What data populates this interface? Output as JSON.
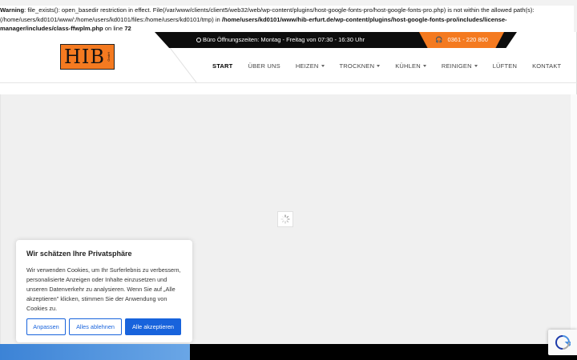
{
  "warning": {
    "label": "Warning",
    "message": ": file_exists(): open_basedir restriction in effect. File(/var/www/clients/client5/web32/web/wp-content/plugins/host-google-fonts-pro/host-google-fonts-pro.php) is not within the allowed path(s): (/home/users/kd0101/www/:/home/users/kd0101/files:/home/users/kd0101/tmp) in ",
    "path": "/home/users/kd0101/www/hib-erfurt.de/wp-content/plugins/host-google-fonts-pro/includes/license-manager/includes/class-ffwplm.php",
    "on_line": " on line ",
    "line": "72"
  },
  "logo": {
    "text": "HIB",
    "sub": "GmbH"
  },
  "topbar": {
    "hours": "Büro Öffnungszeiten: Montag - Freitag von 07:30 - 16:30 Uhr",
    "phone": "0361 - 220 800"
  },
  "nav": {
    "items": [
      {
        "label": "START"
      },
      {
        "label": "ÜBER UNS"
      },
      {
        "label": "HEIZEN"
      },
      {
        "label": "TROCKNEN"
      },
      {
        "label": "KÜHLEN"
      },
      {
        "label": "REINIGEN"
      },
      {
        "label": "LÜFTEN"
      },
      {
        "label": "KONTAKT"
      }
    ]
  },
  "cookie": {
    "title": "Wir schätzen Ihre Privatsphäre",
    "text": "Wir verwenden Cookies, um Ihr Surferlebnis zu verbessern, personalisierte Anzeigen oder Inhalte einzusetzen und unseren Datenverkehr zu analysieren. Wenn Sie auf „Alle akzeptieren\" klicken, stimmen Sie der Anwendung von Cookies zu.",
    "btn_customize": "Anpassen",
    "btn_reject": "Alles ablehnen",
    "btn_accept": "Alle akzeptieren"
  },
  "colors": {
    "accent": "#f47a20",
    "primary_blue": "#1863dc",
    "topbar": "#0d0d0d"
  }
}
